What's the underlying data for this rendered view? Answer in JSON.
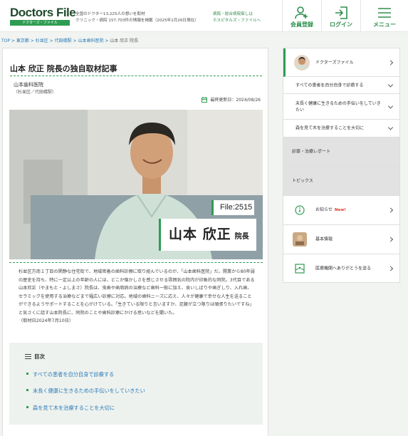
{
  "header": {
    "logo": "Doctors File",
    "logo_sub": "ドクターズ・ファイル",
    "tagline_1": "全国のドクター13,225人の想いを取材",
    "tagline_2": "クリニック・病院 157,703件の情報を掲載（2025年1月26日現在）",
    "hospitals_1": "病院・総合病院探しは",
    "hospitals_2": "ホスピタルズ・ファイルへ",
    "register": "会員登録",
    "login": "ログイン",
    "menu": "メニュー"
  },
  "breadcrumb": [
    "TOP",
    "東京都",
    "杉並区",
    "代田橋駅",
    "山本歯科医院",
    "山本 欣正 院長"
  ],
  "article": {
    "title": "山本 欣正 院長の独自取材記事",
    "clinic": "山本歯科医院",
    "area": "（杉並区／代田橋駅）",
    "updated": "最終更新日：2024/08/26",
    "file_no": "File:2515",
    "doctor_name": "山本 欣正",
    "role": "院長",
    "body": "杉並区方南１丁目の閑静な住宅街で、地域密着の歯科診療に取り組んでいるのが、「山本歯科医院」だ。開業から80年弱の歴史を持ち、特に一定以上の年齢の人には、どこか懐かしさを感じさせる雰囲気の院内が印象的な同院。3代目である山本欣正（やまもと・よしまさ）院長は、虫歯や歯周病の治療など歯科一般に加え、食いしばりや歯ぎしり、入れ歯、セラミックを使用する治療などまで幅広い診療に対応。地域の歯科ニーズに応え、人々が健康で幸せな人生を送ることができるようサポートすることを心がけている。「生きている限りと言いますか、足腰が立つ限りは頑張りたいですね」と気さくに話す山本院長に、同院のことや歯科診療にかける思いなどを聞いた。",
    "date": "（取材日2024年7月10日）"
  },
  "toc": {
    "heading": "目次",
    "items": [
      "すべての患者を自分自身で診療する",
      "末長く健康に生きるための手伝いをしていきたい",
      "森を見て木を治療することを大切に"
    ]
  },
  "sidebar": {
    "doctors_file": "ドクターズファイル",
    "items": [
      "すべての患者を自分自身で診療する",
      "末長く健康に生きるための手伝いをしていきたい",
      "森を見て木を治療することを大切に"
    ],
    "report": "診察・治療レポート",
    "topics": "トピックス",
    "notice": "お知らせ",
    "new": "New!",
    "basic": "基本情報",
    "thanks": "医療機関へありがとうを送る"
  },
  "colors": {
    "brand_green": "#2f9c52",
    "link_blue": "#2a7ab8",
    "new_red": "#e0352b"
  }
}
